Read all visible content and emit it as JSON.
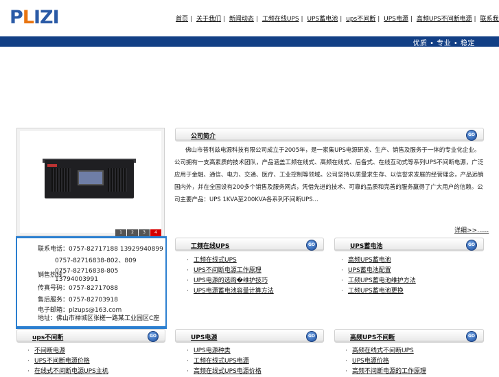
{
  "logo": {
    "text_main": "P",
    "text_l": "L",
    "text_rest": "IZI"
  },
  "nav": {
    "items": [
      "首页",
      "关于我们",
      "新闻动态",
      "工频在线UPS",
      "UPS蓄电池",
      "ups不间断",
      "UPS电源",
      "高频UPS不间断电源",
      "联系我们"
    ]
  },
  "slogan": "优质 • 专业 • 稳定",
  "product_panel": {
    "thumbs": [
      "1",
      "2",
      "3",
      "4"
    ],
    "active_thumb": 3
  },
  "contact": {
    "phone_label": "联系电话：",
    "phone": "0757-82717188 13929940899",
    "line2": "0757-82716838-802、809",
    "mobile_label": "销售热线：",
    "line3": "0757-82716838-805",
    "line4": "13794003991",
    "fax_label": "传真号码：",
    "fax": "0757-82717088",
    "service_label": "售后服务：",
    "service": "0757-82703918",
    "email_label": "电子邮箱：",
    "email": "plzups@163.com",
    "address": "地址：佛山市禅城区张槎一路某工业园区C座"
  },
  "about": {
    "title": "公司简介",
    "body": "佛山市普利兹电源科技有限公司成立于2005年，是一家集UPS电源研发、生产、销售及服务于一体的专业化企业。公司拥有一支高素质的技术团队，产品涵盖工频在线式、高频在线式、后备式、在线互动式等系列UPS不间断电源，广泛应用于金融、通信、电力、交通、医疗、工业控制等领域。公司坚持以质量求生存、以信誉求发展的经营理念，产品远销国内外，并在全国设有200多个销售及服务网点，凭借先进的技术、可靠的品质和完善的服务赢得了广大用户的信赖。公司主要产品：UPS 1KVA至200KVA各系列不间断UPS...",
    "more": "详细>>......"
  },
  "sections": {
    "s1": {
      "title": "工频在线UPS",
      "items": [
        "工频在线式UPS",
        "UPS不间断电源工作原理",
        "UPS电源的选购�维护技巧",
        "UPS电源蓄电池容量计算方法"
      ]
    },
    "s2": {
      "title": "UPS蓄电池",
      "items": [
        "高频UPS蓄电池",
        "UPS蓄电池配置",
        "工频UPS蓄电池维护方法",
        "工频UPS蓄电池更换"
      ]
    },
    "s3": {
      "title": "ups不间断",
      "items": [
        "不间断电源",
        "UPS不间断电源价格",
        "在线式不间断电源UPS主机"
      ]
    },
    "s4": {
      "title": "UPS电源",
      "items": [
        "UPS电源种类",
        "工频在线式UPS电源",
        "高频在线式UPS电源价格"
      ]
    },
    "s5": {
      "title": "高频UPS不间断",
      "items": [
        "高频在线式不间断UPS",
        "UPS电源价格",
        "高频不间断电源的工作原理"
      ]
    }
  },
  "colors": {
    "nav_bar": "#123f85",
    "accent_blue": "#2b7fd0",
    "active_thumb": "#d60000"
  }
}
